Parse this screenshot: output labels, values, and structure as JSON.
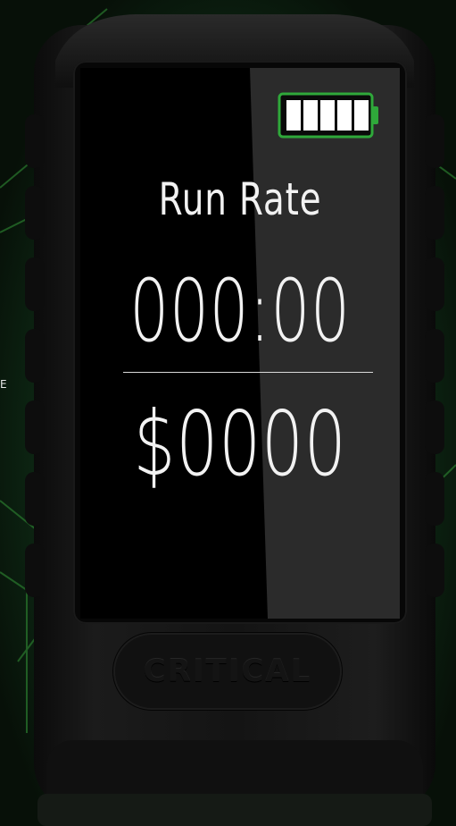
{
  "display": {
    "title": "Run Rate",
    "time": "000:00",
    "amount": "$0000"
  },
  "battery": {
    "bars": 5,
    "level": 1.0
  },
  "device": {
    "brand": "CRITICAL"
  },
  "edge_text": "E",
  "icons": {
    "battery": "battery-full-icon"
  },
  "colors": {
    "accent": "#2fa83a",
    "screen_text": "#f2f2f2",
    "screen_bg": "#000000",
    "shell": "#151515",
    "background_glow": "#1d5a22"
  }
}
